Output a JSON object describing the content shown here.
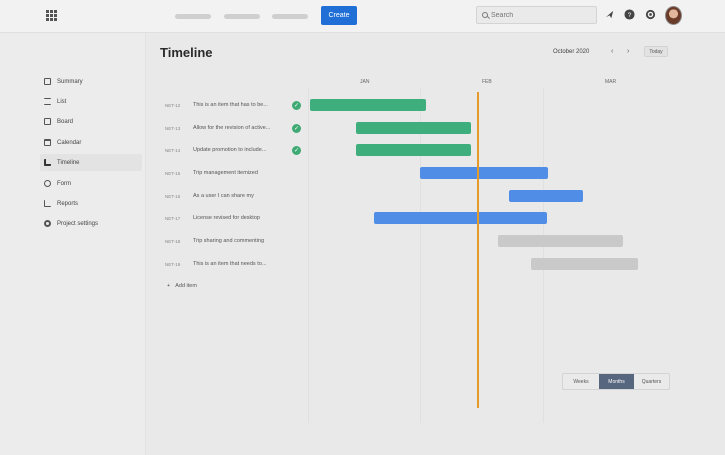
{
  "topbar": {
    "nav_pills": [
      "",
      "",
      ""
    ],
    "create_label": "Create",
    "search_placeholder": "Search",
    "icons": [
      "apps-icon",
      "search-icon",
      "notification-icon",
      "help-icon",
      "settings-icon",
      "avatar"
    ]
  },
  "sidebar": {
    "items": [
      {
        "label": "Summary",
        "icon": "summary-icon"
      },
      {
        "label": "List",
        "icon": "list-icon"
      },
      {
        "label": "Board",
        "icon": "board-icon"
      },
      {
        "label": "Calendar",
        "icon": "calendar-icon"
      },
      {
        "label": "Timeline",
        "icon": "timeline-icon",
        "active": true
      },
      {
        "label": "Form",
        "icon": "form-icon"
      },
      {
        "label": "Reports",
        "icon": "reports-icon"
      },
      {
        "label": "Project settings",
        "icon": "settings-icon"
      }
    ]
  },
  "main": {
    "title": "Timeline",
    "month": "October 2020",
    "prev_arrow": "‹",
    "next_arrow": "›",
    "today_label": "Today",
    "months": [
      "JAN",
      "FEB",
      "MAR"
    ],
    "rows": [
      {
        "key": "NET-12",
        "summary": "This is an item that has to be...",
        "done": true
      },
      {
        "key": "NET-13",
        "summary": "Allow for the revision of active...",
        "done": true
      },
      {
        "key": "NET-14",
        "summary": "Update promotion to include...",
        "done": true
      },
      {
        "key": "NET-15",
        "summary": "Trip management itemized",
        "done": false
      },
      {
        "key": "NET-16",
        "summary": "As a user I can share my",
        "done": false
      },
      {
        "key": "NET-17",
        "summary": "License revised for desktop",
        "done": false
      },
      {
        "key": "NET-18",
        "summary": "Trip sharing and commenting",
        "done": false
      },
      {
        "key": "NET-19",
        "summary": "This is an item that needs to...",
        "done": false
      }
    ],
    "add_item_label": "Add item",
    "view_options": [
      "Weeks",
      "Months",
      "Quarters"
    ],
    "selected_view": "Months"
  },
  "colors": {
    "accent": "#1f6fd6",
    "done_green": "#3fae7d",
    "in_progress_blue": "#4f8de6",
    "todo_grey": "#c9c9c9",
    "today_marker": "#e59a2a"
  }
}
